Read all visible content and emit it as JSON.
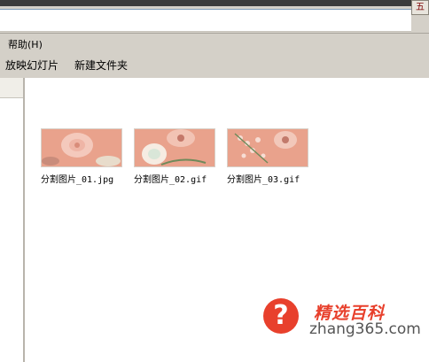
{
  "window": {
    "corner_button": "五"
  },
  "menu": {
    "help_label": "帮助(H)"
  },
  "toolbar": {
    "slideshow_label": "放映幻灯片",
    "new_folder_label": "新建文件夹"
  },
  "files": [
    {
      "name": "分割图片_01.jpg"
    },
    {
      "name": "分割图片_02.gif"
    },
    {
      "name": "分割图片_03.gif"
    }
  ],
  "watermark": {
    "brand": "精选百科",
    "domain": "zhang365.com",
    "icon": "question-mark-icon",
    "color": "#e8402c"
  }
}
